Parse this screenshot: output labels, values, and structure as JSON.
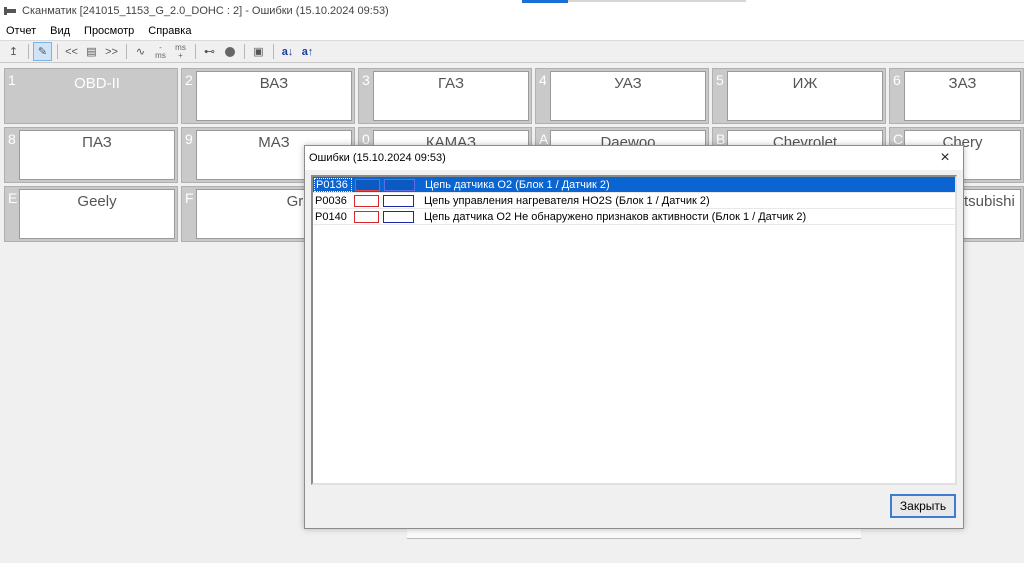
{
  "window": {
    "title": "Сканматик [241015_1153_G_2.0_DOHC : 2] - Ошибки (15.10.2024  09:53)"
  },
  "menu": {
    "items": [
      "Отчет",
      "Вид",
      "Просмотр",
      "Справка"
    ]
  },
  "toolbar": {
    "items": [
      {
        "icon": "upload-arrow-icon",
        "label": "↥"
      },
      {
        "icon": "edit-document-icon",
        "label": "✎"
      },
      {
        "icon": "prev-icon",
        "label": "<<"
      },
      {
        "icon": "list-icon",
        "label": "▤"
      },
      {
        "icon": "next-icon",
        "label": ">>"
      },
      {
        "icon": "wave-icon",
        "label": "∿"
      },
      {
        "icon": "ms-minus-icon",
        "label": "ms"
      },
      {
        "icon": "ms-plus-icon",
        "label": "ms"
      },
      {
        "icon": "plug-icon",
        "label": "⊷"
      },
      {
        "icon": "record-icon",
        "label": ""
      },
      {
        "icon": "image-icon",
        "label": "▣"
      },
      {
        "icon": "font-decrease-icon",
        "label": "a↓"
      },
      {
        "icon": "font-increase-icon",
        "label": "a↑"
      }
    ]
  },
  "brands": [
    {
      "index": "1",
      "name": "OBD-II",
      "selected": true
    },
    {
      "index": "2",
      "name": "ВАЗ"
    },
    {
      "index": "3",
      "name": "ГАЗ"
    },
    {
      "index": "4",
      "name": "УАЗ"
    },
    {
      "index": "5",
      "name": "ИЖ"
    },
    {
      "index": "6",
      "name": "ЗАЗ"
    },
    {
      "index": "8",
      "name": "ПАЗ"
    },
    {
      "index": "9",
      "name": "МАЗ"
    },
    {
      "index": "0",
      "name": "КАМАЗ"
    },
    {
      "index": "A",
      "name": "Daewoo"
    },
    {
      "index": "B",
      "name": "Chevrolet"
    },
    {
      "index": "C",
      "name": "Chery"
    },
    {
      "index": "E",
      "name": "Geely"
    },
    {
      "index": "F",
      "name": "Greatwall"
    },
    {
      "index": "",
      "name": "tsubishi"
    }
  ],
  "dialog": {
    "title": "Ошибки (15.10.2024  09:53)",
    "close_icon": "×",
    "close_button": "Закрыть",
    "errors": [
      {
        "code": "P0136",
        "description": "Цепь датчика O2 (Блок 1 / Датчик 2)",
        "selected": true
      },
      {
        "code": "P0036",
        "description": "Цепь управления нагревателя HO2S (Блок 1 / Датчик 2)"
      },
      {
        "code": "P0140",
        "description": "Цепь датчика O2 Не обнаружено признаков активности (Блок 1 / Датчик 2)"
      }
    ]
  },
  "colors": {
    "selection": "#0a64d2",
    "swatch_red": "#d42a2a",
    "swatch_blue": "#1d28a8"
  }
}
